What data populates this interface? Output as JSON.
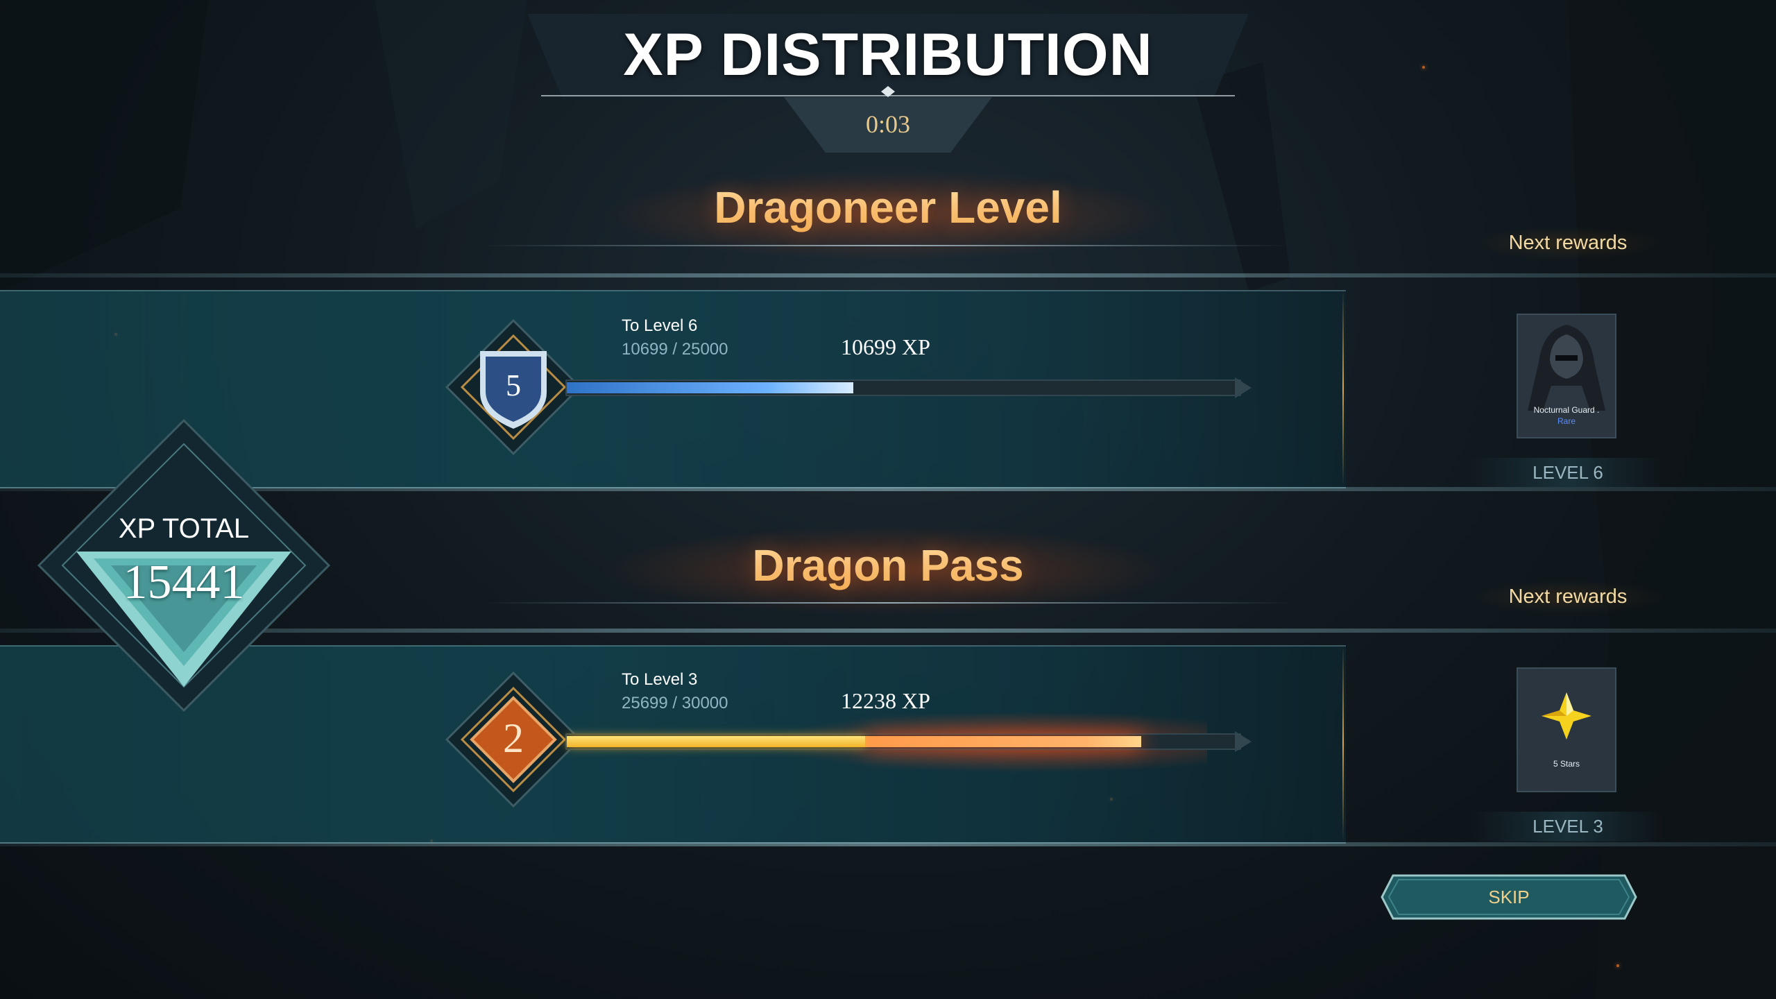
{
  "header": {
    "title": "XP DISTRIBUTION",
    "timer": "0:03"
  },
  "xp_total": {
    "label": "XP TOTAL",
    "value": "15441"
  },
  "sections": [
    {
      "title": "Dragoneer Level",
      "current_level": "5",
      "to_level": "To Level 6",
      "progress_text": "10699 / 25000",
      "xp_gain": "10699 XP",
      "progress_fraction": 0.428,
      "next_rewards_label": "Next rewards",
      "reward": {
        "name": "Nocturnal Guard .",
        "rarity": "Rare",
        "level_label": "LEVEL 6",
        "icon": "hooded-knight-portrait"
      },
      "bar_color": "#6cb2ff",
      "emblem_color": "#2c4f86"
    },
    {
      "title": "Dragon Pass",
      "current_level": "2",
      "to_level": "To Level 3",
      "progress_text": "25699 / 30000",
      "xp_gain": "12238 XP",
      "progress_fraction": 0.857,
      "previous_fraction": 0.445,
      "next_rewards_label": "Next rewards",
      "reward": {
        "name": "5 Stars",
        "level_label": "LEVEL 3",
        "icon": "gold-star-icon"
      },
      "bar_color": "#f3b32a",
      "emblem_color": "#c4571c"
    }
  ],
  "buttons": {
    "skip": "SKIP"
  },
  "colors": {
    "accent_gold": "#f3b45a",
    "panel_teal": "#12464f",
    "skip_teal": "#1e5a60"
  }
}
